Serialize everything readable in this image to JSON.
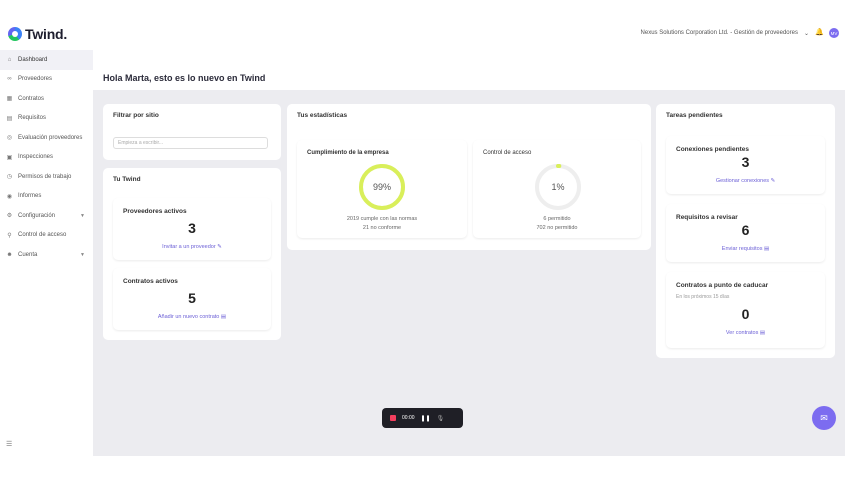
{
  "app": {
    "logo_text": "Twind."
  },
  "topbar": {
    "company": "Nexus Solutions Corporation Ltd. - Gestión de proveedores",
    "avatar_initials": "MV"
  },
  "sidebar": {
    "items": [
      {
        "label": "Dashboard",
        "icon": "home-icon"
      },
      {
        "label": "Proveedores",
        "icon": "link-icon"
      },
      {
        "label": "Contratos",
        "icon": "grid-icon"
      },
      {
        "label": "Requisitos",
        "icon": "document-icon"
      },
      {
        "label": "Evaluación proveedores",
        "icon": "check-circle-icon"
      },
      {
        "label": "Inspecciones",
        "icon": "clipboard-icon"
      },
      {
        "label": "Permisos de trabajo",
        "icon": "clock-icon"
      },
      {
        "label": "Informes",
        "icon": "eye-icon"
      },
      {
        "label": "Configuración",
        "icon": "gear-icon"
      },
      {
        "label": "Control de acceso",
        "icon": "key-icon"
      },
      {
        "label": "Cuenta",
        "icon": "user-icon"
      }
    ]
  },
  "main": {
    "greeting": "Hola Marta, esto es lo nuevo en Twind",
    "filter": {
      "title": "Filtrar por sitio",
      "placeholder": "Empieza a escribir..."
    },
    "tu_twind": {
      "title": "Tu Twind",
      "providers": {
        "title": "Proveedores activos",
        "value": "3",
        "link": "Invitar a un proveedor"
      },
      "contracts": {
        "title": "Contratos activos",
        "value": "5",
        "link": "Añadir un nuevo contrato"
      }
    },
    "stats": {
      "title": "Tus estadísticas",
      "compliance": {
        "title": "Cumplimiento de la empresa",
        "percent": 99,
        "percent_label": "99%",
        "line1": "2019 cumple con las normas",
        "line2": "21 no conforme",
        "color": "#d9ef5a"
      },
      "access": {
        "title": "Control de acceso",
        "percent": 1,
        "percent_label": "1%",
        "line1": "6 permitido",
        "line2": "702 no permitido",
        "color": "#d9ef5a"
      }
    },
    "tasks": {
      "title": "Tareas pendientes",
      "connections": {
        "title": "Conexiones pendientes",
        "value": "3",
        "link": "Gestionar conexiones"
      },
      "requirements": {
        "title": "Requisitos a revisar",
        "value": "6",
        "link": "Enviar requisitos"
      },
      "expiring": {
        "title": "Contratos a punto de caducar",
        "subtitle": "En los próximos 15 días",
        "value": "0",
        "link": "Ver contratos"
      }
    }
  },
  "recorder": {
    "time": "00:00"
  },
  "colors": {
    "accent": "#7c6cf0",
    "ring": "#d9ef5a"
  }
}
